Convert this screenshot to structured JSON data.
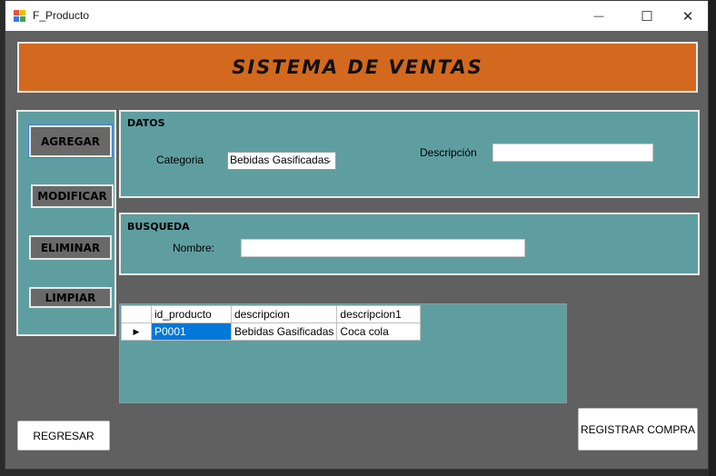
{
  "window": {
    "title": "F_Producto",
    "minimize_glyph": "—",
    "maximize_glyph": "☐",
    "close_glyph": "✕"
  },
  "header": {
    "title": "SISTEMA DE VENTAS"
  },
  "sidebar": {
    "buttons": [
      {
        "label": "AGREGAR"
      },
      {
        "label": "MODIFICAR"
      },
      {
        "label": "ELIMINAR"
      },
      {
        "label": "LIMPIAR"
      }
    ]
  },
  "datos": {
    "group_title": "DATOS",
    "categoria_label": "Categoria",
    "categoria_value": "Bebidas Gasificadas",
    "descripcion_label": "Descripción",
    "descripcion_value": ""
  },
  "busqueda": {
    "group_title": "BUSQUEDA",
    "nombre_label": "Nombre:",
    "nombre_value": ""
  },
  "grid": {
    "columns": [
      "id_producto",
      "descripcion",
      "descripcion1"
    ],
    "rows": [
      {
        "id_producto": "P0001",
        "descripcion": "Bebidas Gasificadas",
        "descripcion1": "Coca cola"
      }
    ]
  },
  "footer": {
    "regresar_label": "REGRESAR",
    "registrar_label": "REGISTRAR COMPRA"
  },
  "colors": {
    "banner": "#d2691e",
    "panel": "#5f9ea0",
    "window_bg": "#606060",
    "selection": "#0078d7"
  }
}
